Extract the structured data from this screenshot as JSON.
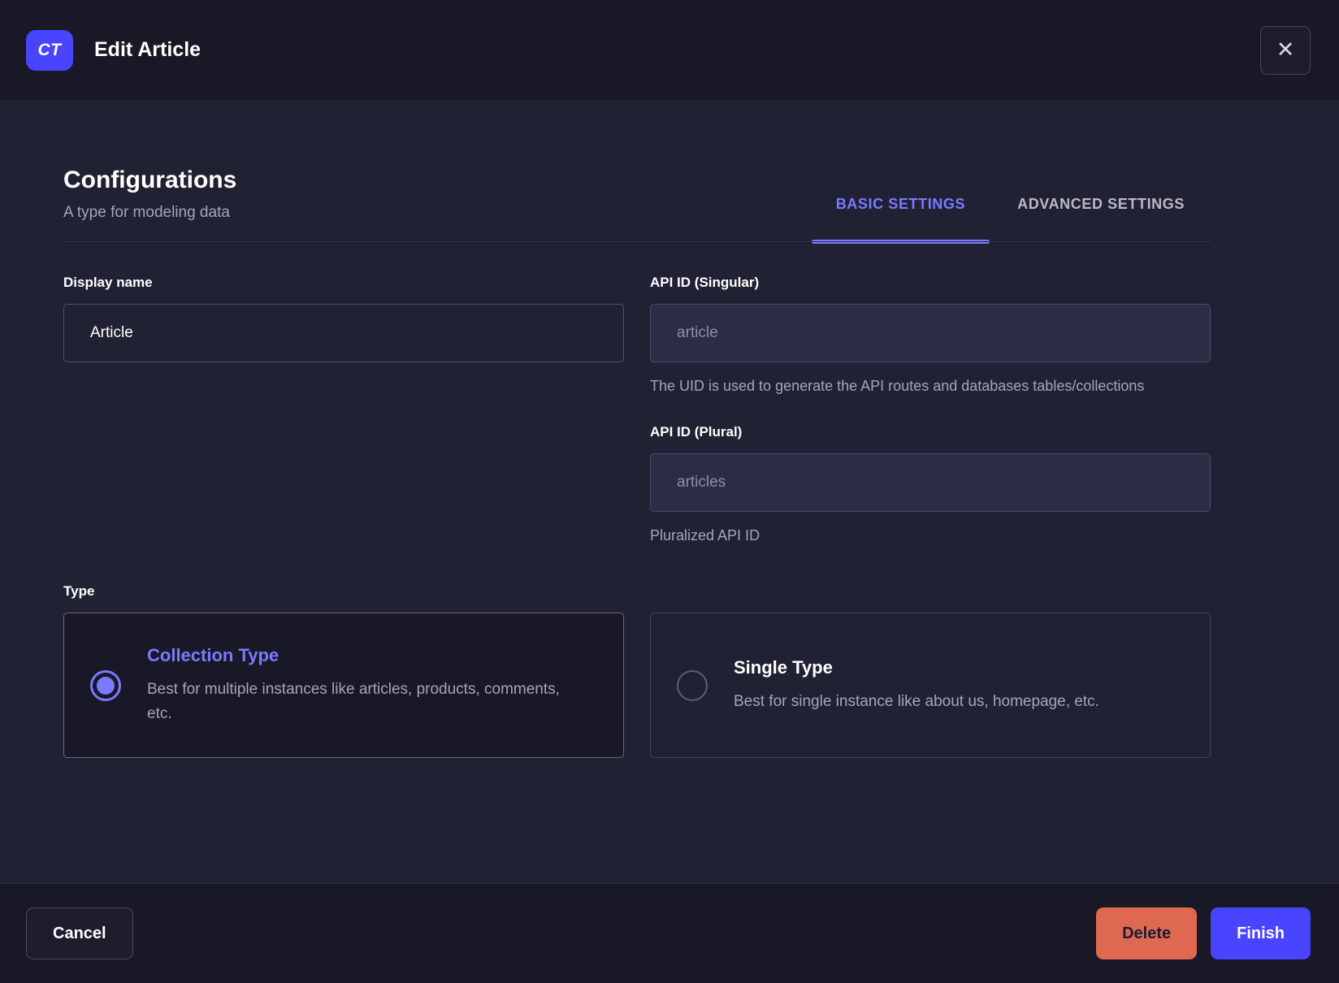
{
  "header": {
    "badge": "CT",
    "title": "Edit Article",
    "close_icon": "✕"
  },
  "main": {
    "title": "Configurations",
    "subtitle": "A type for modeling data",
    "tabs": [
      {
        "label": "BASIC SETTINGS",
        "active": true
      },
      {
        "label": "ADVANCED SETTINGS",
        "active": false
      }
    ],
    "fields": {
      "display_name": {
        "label": "Display name",
        "value": "Article"
      },
      "api_id_singular": {
        "label": "API ID (Singular)",
        "placeholder": "article",
        "help": "The UID is used to generate the API routes and databases tables/collections"
      },
      "api_id_plural": {
        "label": "API ID (Plural)",
        "placeholder": "articles",
        "help": "Pluralized API ID"
      }
    },
    "type_section": {
      "label": "Type",
      "options": [
        {
          "title": "Collection Type",
          "description": "Best for multiple instances like articles, products, comments, etc.",
          "selected": true
        },
        {
          "title": "Single Type",
          "description": "Best for single instance like about us, homepage, etc.",
          "selected": false
        }
      ]
    }
  },
  "footer": {
    "cancel_label": "Cancel",
    "delete_label": "Delete",
    "finish_label": "Finish"
  },
  "colors": {
    "primary": "#4945ff",
    "primary_light": "#7b79ff",
    "danger": "#df6950",
    "header_bg": "#181826",
    "body_bg": "#212134"
  }
}
